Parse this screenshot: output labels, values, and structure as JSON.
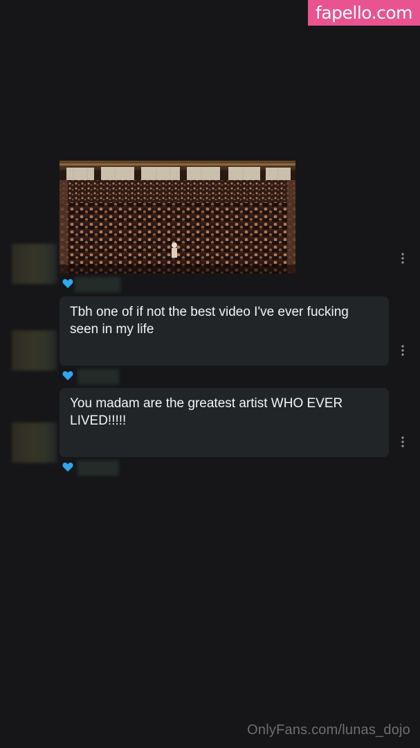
{
  "watermark": {
    "site": "fapello.com",
    "footer": "OnlyFans.com/lunas_dojo",
    "badge_color": "#e9538f"
  },
  "colors": {
    "background": "#161618",
    "bubble": "#222528",
    "text": "#f4f4f4",
    "heart": "#2ea8ee"
  },
  "messages": [
    {
      "type": "media",
      "icon": "heart-icon",
      "menu_icon": "more-vertical-icon"
    },
    {
      "type": "text",
      "text": "Tbh one of if not the best video I've ever fucking seen in my life",
      "icon": "heart-icon",
      "menu_icon": "more-vertical-icon"
    },
    {
      "type": "text",
      "text": "You madam are the greatest artist WHO EVER LIVED!!!!!",
      "icon": "heart-icon",
      "menu_icon": "more-vertical-icon"
    }
  ]
}
